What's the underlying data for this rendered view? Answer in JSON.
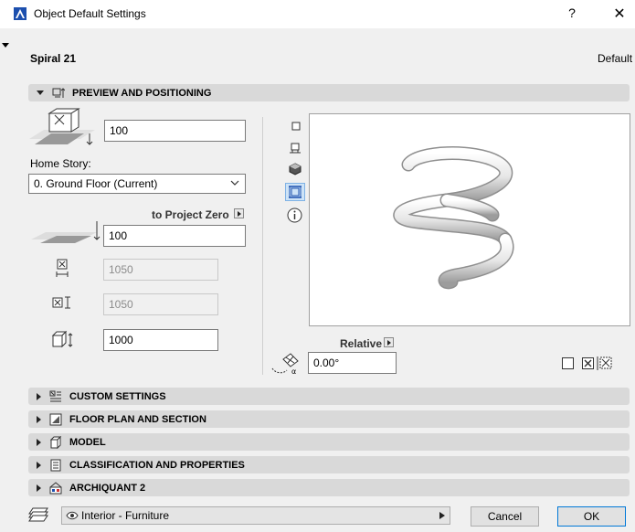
{
  "window": {
    "title": "Object Default Settings",
    "help": "?",
    "close": "✕"
  },
  "object": {
    "name": "Spiral 21",
    "mode": "Default"
  },
  "sections": {
    "preview": "PREVIEW AND POSITIONING",
    "custom": "CUSTOM SETTINGS",
    "floorplan": "FLOOR PLAN AND SECTION",
    "model": "MODEL",
    "classification": "CLASSIFICATION AND PROPERTIES",
    "archiquant": "ARCHIQUANT 2"
  },
  "positioning": {
    "offset_value": "100",
    "home_story_label": "Home Story:",
    "home_story_value": "0. Ground Floor (Current)",
    "reference_label": "to Project Zero",
    "elevation_value": "100",
    "width_value": "1050",
    "depth_value": "1050",
    "height_value": "1000",
    "relative_label": "Relative",
    "angle_value": "0.00°"
  },
  "bottom": {
    "layer_value": "Interior - Furniture",
    "cancel": "Cancel",
    "ok": "OK"
  },
  "colors": {
    "accent": "#0078d7",
    "header_bg": "#d9d9d9"
  }
}
